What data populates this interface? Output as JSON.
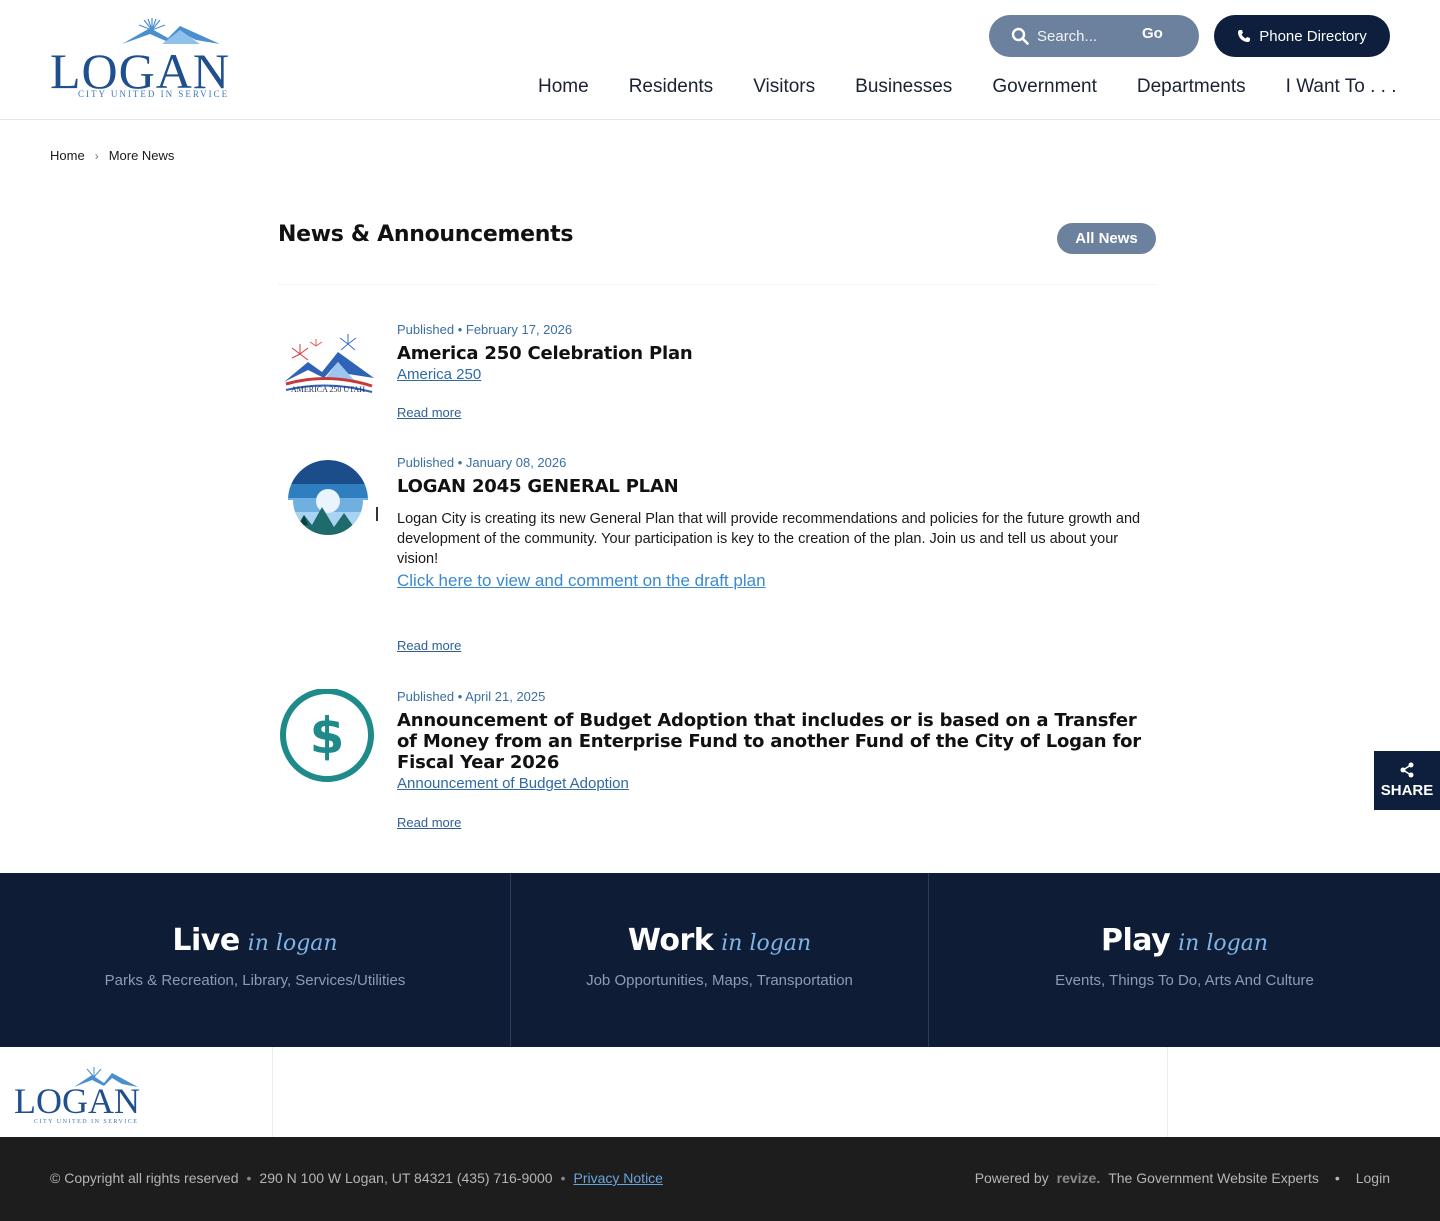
{
  "header": {
    "logo": {
      "word": "LOGAN",
      "tagline": "CITY  UNITED IN SERVICE"
    },
    "search": {
      "placeholder": "Search...",
      "go_label": "Go"
    },
    "phone_button": "Phone Directory",
    "nav": [
      "Home",
      "Residents",
      "Visitors",
      "Businesses",
      "Government",
      "Departments",
      "I Want To . . ."
    ]
  },
  "breadcrumb": {
    "home": "Home",
    "separator": "›",
    "current": "More News"
  },
  "news": {
    "title": "News & Announcements",
    "all_news_label": "All News",
    "posts": [
      {
        "date": "Published • February 17, 2026",
        "title": "America 250 Celebration Plan",
        "link": "America 250",
        "read_more": "Read more",
        "thumb_icon": "america-250-logo-icon",
        "thumb_text": "AMERICA 250 UTAH"
      },
      {
        "date": "Published • January 08, 2026",
        "title": "LOGAN 2045 GENERAL PLAN",
        "description": "Logan City is creating its new General Plan that will provide recommendations and policies for the future growth and development of the community.  Your participation is key to the creation of the plan.  Join us and tell us about your vision!",
        "link": "Click here to view and comment on the draft plan",
        "read_more": "Read more",
        "thumb_icon": "general-plan-mountain-icon"
      },
      {
        "date": "Published • April 21, 2025",
        "title": "Announcement of Budget Adoption that includes or is based on a Transfer of Money from an Enterprise Fund to another Fund of the City of Logan for Fiscal Year 2026",
        "link": "Announcement of Budget Adoption",
        "read_more": "Read more",
        "thumb_icon": "dollar-circle-icon"
      }
    ]
  },
  "share": {
    "label": "SHARE",
    "icon": "share-icon"
  },
  "lwp": [
    {
      "word": "Live",
      "script": "in logan",
      "sub": "Parks & Recreation, Library, Services/Utilities"
    },
    {
      "word": "Work",
      "script": "in logan",
      "sub": "Job Opportunities, Maps, Transportation"
    },
    {
      "word": "Play",
      "script": "in logan",
      "sub": "Events, Things To Do, Arts And Culture"
    }
  ],
  "footer": {
    "copyright": "© Copyright all rights reserved",
    "address": "290 N 100 W Logan, UT 84321 (435) 716-9000",
    "dot": "•",
    "privacy": "Privacy Notice",
    "powered_by": "Powered by",
    "revize": "revize.",
    "experts": "The Government Website Experts",
    "login": "Login"
  },
  "colors": {
    "navy": "#0d1f3c",
    "slate_button": "#6c819d",
    "link_blue": "#2f6aa5",
    "accent_blue": "#3d7ab8",
    "teal": "#1f8a8a"
  }
}
